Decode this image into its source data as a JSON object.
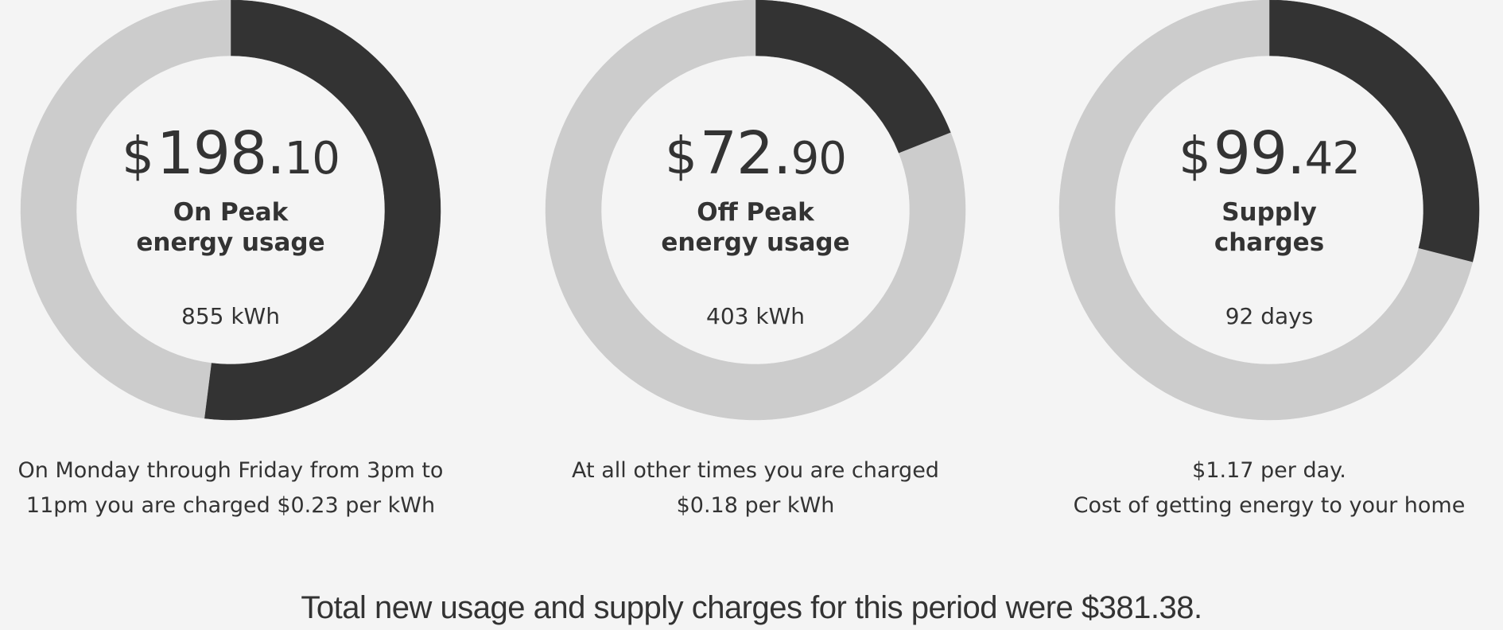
{
  "colors": {
    "filled": "#333333",
    "track": "#cccccc",
    "background": "#f4f4f4",
    "text": "#333333"
  },
  "chart_data": [
    {
      "type": "pie",
      "amount": {
        "currency": "$",
        "dollars": "198.",
        "cents": "10"
      },
      "label_lines": [
        "On Peak",
        "energy usage"
      ],
      "quantity": "855 kWh",
      "description_lines": [
        "On Monday through Friday from 3pm to",
        "11pm you are charged $0.23 per kWh"
      ],
      "slices": [
        0.52,
        0.28,
        0.2
      ]
    },
    {
      "type": "pie",
      "amount": {
        "currency": "$",
        "dollars": "72.",
        "cents": "90"
      },
      "label_lines": [
        "Off Peak",
        "energy usage"
      ],
      "quantity": "403 kWh",
      "description_lines": [
        "At all other times you are charged",
        "$0.18 per kWh"
      ],
      "slices": [
        0.19,
        0.29,
        0.52
      ]
    },
    {
      "type": "pie",
      "amount": {
        "currency": "$",
        "dollars": "99.",
        "cents": "42"
      },
      "label_lines": [
        "Supply",
        "charges"
      ],
      "quantity": "92 days",
      "description_lines": [
        "$1.17 per day.",
        "Cost of getting energy to your home"
      ],
      "slices": [
        0.29,
        0.52,
        0.19
      ]
    }
  ],
  "total_text": "Total new usage and supply charges for this period were  $381.38."
}
